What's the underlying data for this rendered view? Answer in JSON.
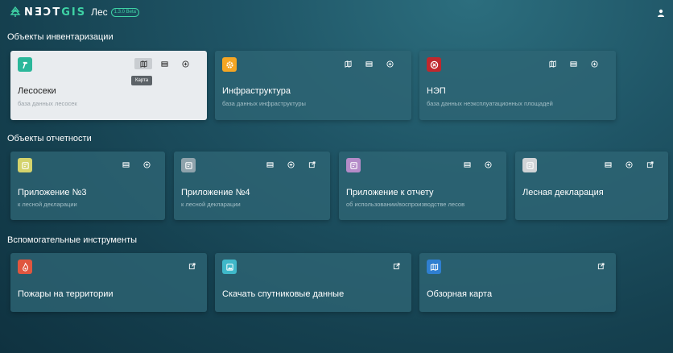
{
  "header": {
    "logo_brand": "NƎĆTGIS",
    "app_name": "Лес",
    "version": "1.3.0 Beta"
  },
  "sections": {
    "inventory": {
      "title": "Объекты инвентаризации",
      "cards": [
        {
          "title": "Лесосеки",
          "subtitle": "база данных лесосек",
          "icon": "hammer-icon",
          "color": "#2bb79a"
        },
        {
          "title": "Инфраструктура",
          "subtitle": "база данных инфраструктуры",
          "icon": "gear-icon",
          "color": "#f5a623"
        },
        {
          "title": "НЭП",
          "subtitle": "база данных неэксплуатационных площадей",
          "icon": "cancel-icon",
          "color": "#c0282d"
        }
      ]
    },
    "reports": {
      "title": "Объекты отчетности",
      "cards": [
        {
          "title": "Приложение №3",
          "subtitle": "к лесной декларации",
          "icon": "note-icon",
          "color": "#d4d36c"
        },
        {
          "title": "Приложение №4",
          "subtitle": "к лесной декларации",
          "icon": "note-icon",
          "color": "#8fa3ac"
        },
        {
          "title": "Приложение к отчету",
          "subtitle": "об использовании/воспроизводстве лесов",
          "icon": "note-icon",
          "color": "#b48bc8"
        },
        {
          "title": "Лесная декларация",
          "subtitle": "",
          "icon": "note-icon",
          "color": "#d0d3d6"
        }
      ]
    },
    "tools": {
      "title": "Вспомогательные инструменты",
      "cards": [
        {
          "title": "Пожары на территории",
          "icon": "fire-icon",
          "color": "#e0563f"
        },
        {
          "title": "Скачать спутниковые данные",
          "icon": "image-icon",
          "color": "#3fb8c9"
        },
        {
          "title": "Обзорная карта",
          "icon": "map-icon",
          "color": "#2f7fd1"
        }
      ]
    }
  },
  "tooltip": {
    "text": "Карта"
  }
}
